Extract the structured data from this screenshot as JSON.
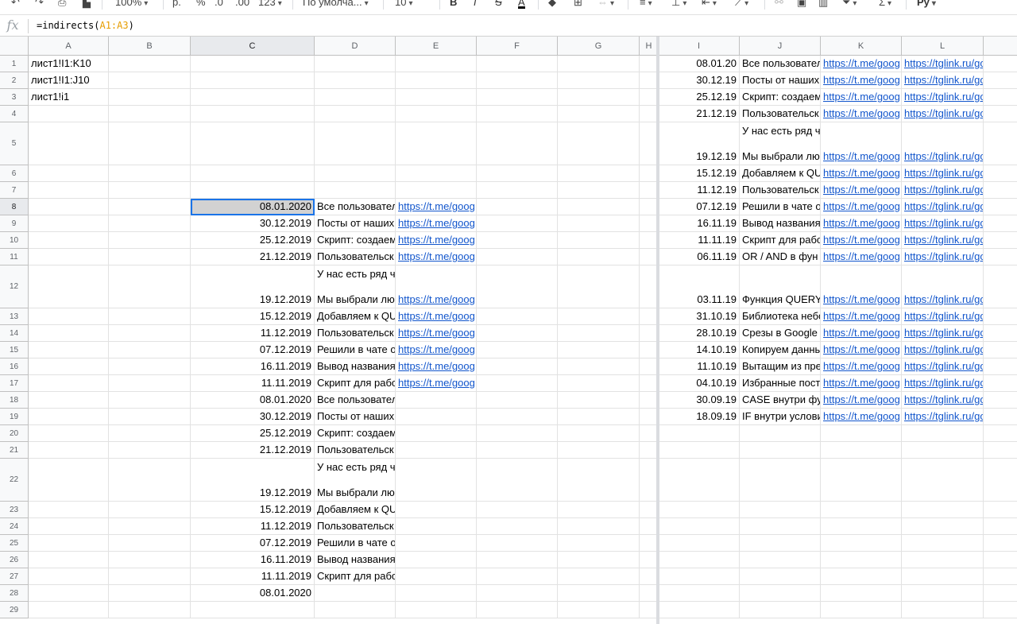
{
  "toolbar": {
    "zoom": "100%",
    "currency": "р.",
    "percent": "%",
    "dec_decrease": ".0",
    "dec_increase": ".00",
    "format": "123",
    "font": "По умолча...",
    "font_size": "10",
    "bold": "B",
    "italic": "I",
    "strike": "S",
    "text_color": "A",
    "sum": "Σ"
  },
  "formula_bar": {
    "fx": "fx",
    "prefix": "=indirects(",
    "ref": "A1:A3",
    "suffix": ")"
  },
  "columns": [
    "A",
    "B",
    "C",
    "D",
    "E",
    "F",
    "G",
    "H",
    "I",
    "J",
    "K",
    "L"
  ],
  "rows": [
    "1",
    "2",
    "3",
    "4",
    "5",
    "6",
    "7",
    "8",
    "9",
    "10",
    "11",
    "12",
    "13",
    "14",
    "15",
    "16",
    "17",
    "18",
    "19",
    "20",
    "21",
    "22",
    "23",
    "24",
    "25",
    "26",
    "27",
    "28",
    "29"
  ],
  "colA": [
    "лист1!I1:K10",
    "лист1!I1:J10",
    "лист1!i1"
  ],
  "colC": [
    "08.01.2020",
    "30.12.2019",
    "25.12.2019",
    "21.12.2019",
    "19.12.2019",
    "15.12.2019",
    "11.12.2019",
    "07.12.2019",
    "16.11.2019",
    "11.11.2019",
    "08.01.2020",
    "30.12.2019",
    "25.12.2019",
    "21.12.2019",
    "19.12.2019",
    "15.12.2019",
    "11.12.2019",
    "07.12.2019",
    "16.11.2019",
    "11.11.2019",
    "08.01.2020"
  ],
  "colD": [
    "Все пользовател",
    "Посты от наших",
    "Скрипт: создаем",
    "Пользовательск",
    "У нас есть ряд ч\n\nМы выбрали лю",
    "Добавляем к QU",
    "Пользовательск",
    "Решили в чате о",
    "Вывод названия",
    "Скрипт для рабо",
    "Все пользовател",
    "Посты от наших",
    "Скрипт: создаем",
    "Пользовательск",
    "У нас есть ряд ч\n\nМы выбрали лю",
    "Добавляем к QU",
    "Пользовательск",
    "Решили в чате о",
    "Вывод названия",
    "Скрипт для рабо"
  ],
  "colE": [
    "https://t.me/goog",
    "https://t.me/goog",
    "https://t.me/goog",
    "https://t.me/goog",
    "https://t.me/goog",
    "https://t.me/goog",
    "https://t.me/goog",
    "https://t.me/goog",
    "https://t.me/goog",
    "https://t.me/goog"
  ],
  "colI": [
    "08.01.20",
    "30.12.19",
    "25.12.19",
    "21.12.19",
    "19.12.19",
    "15.12.19",
    "11.12.19",
    "07.12.19",
    "16.11.19",
    "11.11.19",
    "06.11.19",
    "03.11.19",
    "31.10.19",
    "28.10.19",
    "14.10.19",
    "11.10.19",
    "04.10.19",
    "30.09.19",
    "18.09.19"
  ],
  "colJ": [
    "Все пользовател",
    "Посты от наших",
    "Скрипт: создаем",
    "Пользовательск",
    "У нас есть ряд ч\n\nМы выбрали лю",
    "Добавляем к QU",
    "Пользовательск",
    "Решили в чате о",
    "Вывод названия",
    "Скрипт для рабо",
    "OR / AND в фун",
    "\n\nФункция QUERY",
    "Библиотека небо",
    "Срезы в Google",
    "Копируем данны",
    "Вытащим из пре",
    "Избранные пост",
    "CASE внутри фу",
    "IF внутри услови"
  ],
  "colK": "https://t.me/goog",
  "colL": "https://tglink.ru/google_s"
}
